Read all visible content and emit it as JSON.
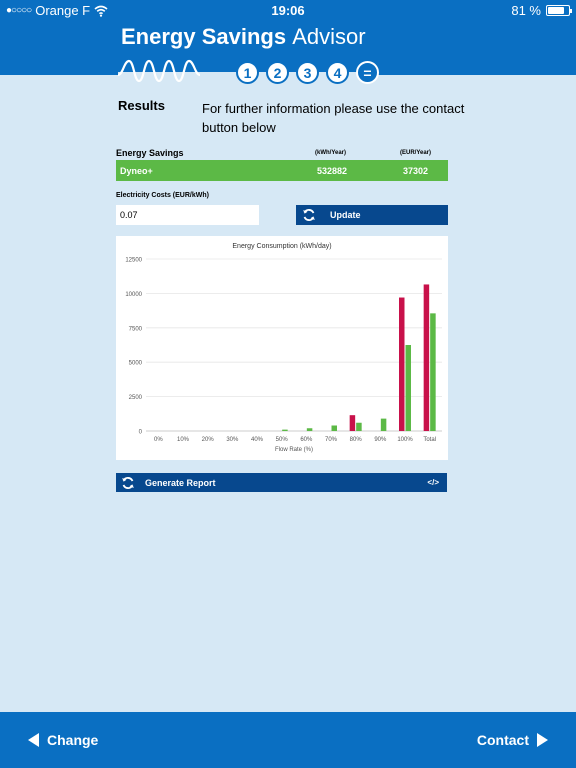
{
  "status_bar": {
    "signal_dots": "●○○○○",
    "carrier": "Orange F",
    "time": "19:06",
    "battery_text": "81 %",
    "battery_level": 0.81
  },
  "header": {
    "title_bold": "Energy Savings",
    "title_light": "Advisor",
    "steps": [
      "1",
      "2",
      "3",
      "4",
      "="
    ]
  },
  "results": {
    "label": "Results",
    "info": "For further information please use the contact button below"
  },
  "savings": {
    "title": "Energy Savings",
    "col_kwh": "(kWh/Year)",
    "col_eur": "(EUR/Year)",
    "product": "Dyneo+",
    "kwh": "532882",
    "eur": "37302"
  },
  "costs": {
    "label": "Electricity Costs (EUR/kWh)",
    "value": "0.07",
    "update_label": "Update"
  },
  "chart_data": {
    "type": "bar",
    "title": "Energy Consumption (kWh/day)",
    "xlabel": "Flow Rate (%)",
    "ylabel": "",
    "ylim": [
      0,
      12500
    ],
    "yticks": [
      0,
      2500,
      5000,
      7500,
      10000,
      12500
    ],
    "categories": [
      "0%",
      "10%",
      "20%",
      "30%",
      "40%",
      "50%",
      "60%",
      "70%",
      "80%",
      "90%",
      "100%",
      "Total"
    ],
    "series": [
      {
        "color": "#c8114a",
        "values": [
          0,
          0,
          0,
          0,
          0,
          0,
          0,
          0,
          1150,
          0,
          9700,
          10650
        ]
      },
      {
        "color": "#5cb946",
        "values": [
          0,
          0,
          0,
          0,
          0,
          100,
          200,
          400,
          600,
          900,
          6250,
          8550
        ]
      }
    ],
    "grid": true,
    "legend": "none"
  },
  "report": {
    "label": "Generate Report",
    "code_symbol": "</>"
  },
  "footer": {
    "change_label": "Change",
    "contact_label": "Contact"
  },
  "colors": {
    "brand_blue": "#0a6fc2",
    "dark_blue": "#07488e",
    "green": "#5cb946",
    "red": "#c8114a",
    "background": "#d6e8f5"
  }
}
